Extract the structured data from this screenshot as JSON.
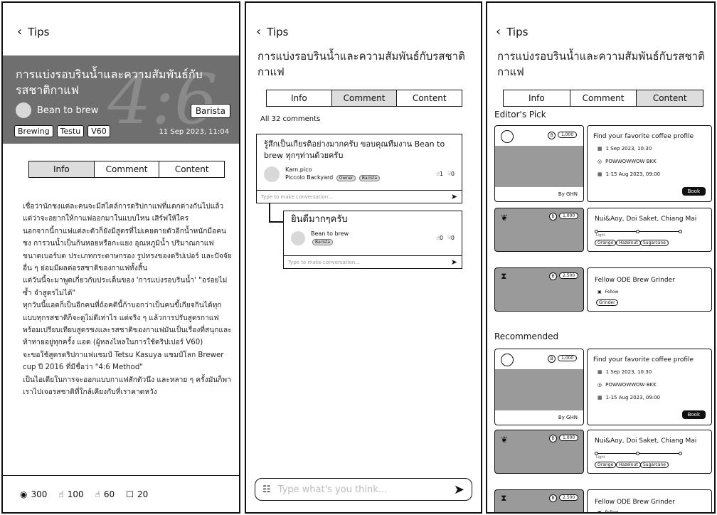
{
  "back_label": "Tips",
  "article": {
    "title": "การแบ่งรอบรินน้ำและความสัมพันธ์กับรสชาติกาแฟ",
    "hero_bg_text": "4:6",
    "author": "Bean to brew",
    "role": "Barista",
    "tags": [
      "Brewing",
      "Testu",
      "V60"
    ],
    "date": "11 Sep 2023, 11:04",
    "paragraphs": [
      "      เชื่อว่านักชงแต่ละคนจะมีสไตล์การดริปกาแฟที่แตกต่างกันไปแล้วแต่ว่าจะอยากให้กาแฟออกมาในแบบไหน เสิร์ฟให้ใคร",
      "นอกจากนี้กาแฟแต่ละตัวก็ยังมีสูตรที่ไม่เคยตายตัวอีกน้ำหนักมือคนชง การวนน้ำเป็นก้นหอยหรือกะแยง อุณหภูมิน้ำ ปริมาณกาแฟ ขนาดเบอร์บด ประเภทกระดาษกรอง รูปทรงของดริปเปอร์ และปัจจัยอื่น ๆ ย่อมมีผลต่อรสชาติของกาแฟทั้งสิ้น",
      " แต่วันนี้จะมาพูดเกี่ยวกับประเด็นของ 'การแบ่งรอบรินน้ำ' \"อร่อยไม่ซ้ำ จำสูตรไม่ได้\"",
      "ทุกวันนี้แอดก็เป็นอีกคนที่ถ้อคตินี้ก้าบอกว่าเป็นคนขี้เกียจกินได้ทุกแบบทุกรสชาติก็จะดูไม่ดีเท่าไร แต่จริง ๆ แล้วการปรับสูตรกาแฟพร้อมเปรียบเทียบสูตรชงและรสชาติของกาแฟมันเป็นเรื่องที่สนุกและท้าทายอยู่ทุกครั้ง แอด (ผู้หลงไหลในการใช้ดริปเปอร์ V60)",
      "จะขอใช้สูตรดริปกาแฟแชมป์ Tetsu Kasuya แชมป์โลก Brewer cup ปี 2016 ที่มีชื่อว่า \"4:6 Method\"",
      "เป็นไอเดียในการจะออกแบบกาแฟสักตัวนึง และหลาย ๆ ครั้งมันก็พาเราไปเจอรสชาติที่ใกล้เคียงกับที่เราคาดหวัง"
    ],
    "stats": {
      "views": "300",
      "likes": "100",
      "dislikes": "60",
      "saves": "20"
    }
  },
  "tabs": [
    "Info",
    "Comment",
    "Content"
  ],
  "comments": {
    "count_label": "All 32 comments",
    "items": [
      {
        "text": "รู้สึกเป็นเกียรติอย่างมากครับ ขอบคุณทีมงาน Bean to brew ทุกๆท่านด้วยครับ",
        "name": "Karn.pico",
        "shop": "Piccolo Backyard",
        "badges": [
          "Owner",
          "Barista"
        ],
        "likes": "1",
        "dislikes": "0"
      }
    ],
    "reply": {
      "text": "ยินดีมากๆครับ",
      "name": "Bean to brew",
      "badge": "Barista",
      "likes": "0",
      "dislikes": "0"
    },
    "type_placeholder": "Type to make conversation...",
    "bottom_placeholder": "Type what's you think..."
  },
  "content": {
    "editors_pick_label": "Editor's Pick",
    "recommended_label": "Recommended",
    "event": {
      "badge": "1,000",
      "title": "Find your favorite coffee profile",
      "date": "1 Sep 2023, 10:30",
      "place": "POWWOWWOW BKK",
      "period": "1-15 Aug 2023, 09:00",
      "by": "By GHN",
      "book": "Book"
    },
    "bean": {
      "badge": "1,000",
      "title": "Nui&Aoy, Doi Saket, Chiang Mai",
      "scale_label": "Light",
      "notes": [
        "Orange",
        "Hazelnut",
        "Sugarcane"
      ]
    },
    "grinder": {
      "badge": "2,500",
      "title": "Fellow ODE Brew Grinder",
      "brand": "Fellow",
      "tag": "Grinder"
    }
  }
}
